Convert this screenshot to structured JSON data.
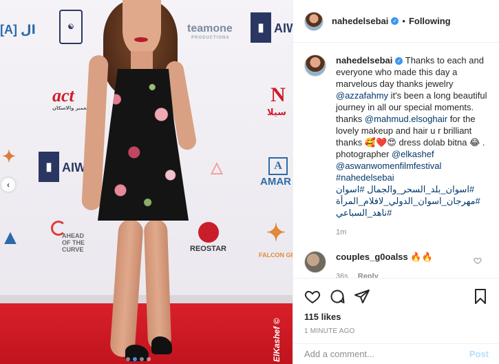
{
  "photo": {
    "logos": {
      "top_left": "[A] ال",
      "teamone": "teamone",
      "teamone_sub": "PRODUCTIONS",
      "aiwi_top": "AIWI",
      "act": "act",
      "act_sub": "بنك التعمير والاسكان",
      "seila": "سيلا",
      "aiwi_mid": "AIWI",
      "amar": "AMAR",
      "ahead_line1": "AHEAD",
      "ahead_line2": "OF THE",
      "ahead_line3": "CURVE",
      "reostar": "REOSTAR",
      "falcon": "FALCON GROUP"
    },
    "watermark": "ElKashef ©"
  },
  "header": {
    "username": "nahedelsebai",
    "separator": "•",
    "follow_state": "Following"
  },
  "caption": {
    "username": "nahedelsebai",
    "text_1": " Thanks to each and everyone who made this day a marvelous day thanks jewelry ",
    "mention_1": "@azzafahmy",
    "text_2": " it's been a long beautiful journey in all our special moments. thanks ",
    "mention_2": "@mahmud.elsoghair",
    "text_3": " for the lovely makeup and hair u r brilliant thanks 🥰❤️😍 dress dolab bitna 😂 . photographer ",
    "mention_3": "@elkashef",
    "mention_4": "@aswanwomenfilmfestival",
    "tag_1": "#nahedelsebai",
    "tag_2": "#اسوان_بلد_السحر_والجمال #اسوان",
    "tag_3": "#مهرجان_اسوان_الدولي_لافلام_المرأة",
    "tag_4": "#ناهد_السباعي",
    "time": "1m"
  },
  "comments": [
    {
      "username": "couples_g0oalss",
      "text": " 🔥🔥",
      "time": "36s",
      "reply": "Reply"
    }
  ],
  "actions": {
    "likes": "115 likes",
    "posted": "1 MINUTE AGO"
  },
  "add_comment": {
    "placeholder": "Add a comment...",
    "post_label": "Post"
  },
  "colors": {
    "mention": "#00376b",
    "verified": "#3897f0",
    "post_disabled": "#b2dffc",
    "carpet": "#d8202a"
  }
}
